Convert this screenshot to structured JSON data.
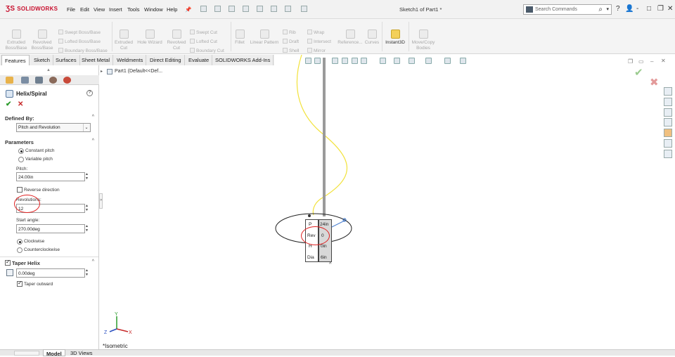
{
  "app": {
    "logo_text": "SOLIDWORKS",
    "doc_title": "Sketch1 of Part1 *",
    "menus": [
      "File",
      "Edit",
      "View",
      "Insert",
      "Tools",
      "Window",
      "Help"
    ],
    "search_placeholder": "Search Commands",
    "window_controls": [
      "?",
      "-",
      "□",
      "✕"
    ]
  },
  "command_manager": {
    "big": [
      {
        "label": "Extruded\nBoss/Base"
      },
      {
        "label": "Revolved\nBoss/Base"
      },
      {
        "label": "Extruded\nCut"
      },
      {
        "label": "Hole Wizard"
      },
      {
        "label": "Revolved\nCut"
      },
      {
        "label": "Fillet"
      },
      {
        "label": "Linear Pattern"
      },
      {
        "label": "Reference..."
      },
      {
        "label": "Curves"
      },
      {
        "label": "Instant3D"
      },
      {
        "label": "Move/Copy\nBodies"
      }
    ],
    "small_left": [
      "Swept Boss/Base",
      "Lofted Boss/Base",
      "Boundary Boss/Base"
    ],
    "small_mid": [
      "Swept Cut",
      "Lofted Cut",
      "Boundary Cut"
    ],
    "small_right": [
      "Rib",
      "Draft",
      "Shell"
    ],
    "small_right2": [
      "Wrap",
      "Intersect",
      "Mirror"
    ]
  },
  "tabs": [
    "Features",
    "Sketch",
    "Surfaces",
    "Sheet Metal",
    "Weldments",
    "Direct Editing",
    "Evaluate",
    "SOLIDWORKS Add-Ins"
  ],
  "property_manager": {
    "title": "Helix/Spiral",
    "help": "?",
    "defined_by": {
      "header": "Defined By:",
      "value": "Pitch and Revolution"
    },
    "parameters": {
      "header": "Parameters",
      "pitch_options": [
        "Constant pitch",
        "Variable pitch"
      ],
      "pitch_label": "Pitch:",
      "pitch_value": "24.00in",
      "reverse_label": "Reverse direction",
      "revolutions_label": "Revolutions:",
      "revolutions_value": "12",
      "start_angle_label": "Start angle:",
      "start_angle_value": "270.00deg",
      "direction_options": [
        "Clockwise",
        "Counterclockwise"
      ]
    },
    "taper": {
      "header": "Taper Helix",
      "angle_value": "0.00deg",
      "outward_label": "Taper outward"
    }
  },
  "tree": {
    "root": "Part1 (Default<<Def..."
  },
  "callout": {
    "rows": [
      {
        "k": "P",
        "v": "24in"
      },
      {
        "k": "Rev",
        "v": "0"
      },
      {
        "k": "H",
        "v": "0in"
      },
      {
        "k": "Dia",
        "v": "6in"
      }
    ]
  },
  "view_label": "*Isometric",
  "bottom_tabs": [
    "Model",
    "3D Views"
  ],
  "triad": {
    "x": "X",
    "y": "Y",
    "z": "Z"
  },
  "colors": {
    "accent": "#c8102e",
    "helix": "#f2e23a",
    "highlight": "#e02020"
  }
}
